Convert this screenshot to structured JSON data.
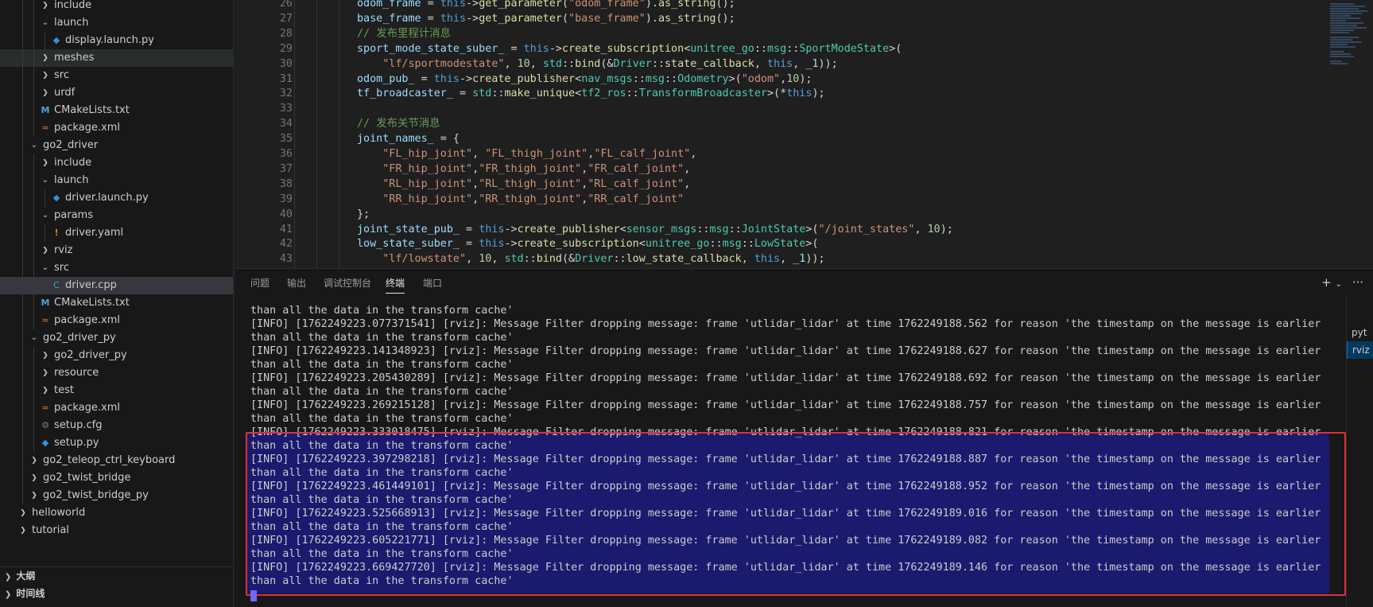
{
  "explorer": {
    "rows": [
      {
        "label": "include",
        "icon": "chevron-right",
        "depth": 2,
        "kind": "folder"
      },
      {
        "label": "launch",
        "icon": "chevron-down",
        "depth": 2,
        "kind": "folder"
      },
      {
        "label": "display.launch.py",
        "icon": "python-icon",
        "depth": 3,
        "kind": "file"
      },
      {
        "label": "meshes",
        "icon": "chevron-right",
        "depth": 2,
        "kind": "folder",
        "state": "hovered"
      },
      {
        "label": "src",
        "icon": "chevron-right",
        "depth": 2,
        "kind": "folder"
      },
      {
        "label": "urdf",
        "icon": "chevron-right",
        "depth": 2,
        "kind": "folder"
      },
      {
        "label": "CMakeLists.txt",
        "icon": "cmake-icon",
        "depth": 2,
        "kind": "file"
      },
      {
        "label": "package.xml",
        "icon": "xml-icon",
        "depth": 2,
        "kind": "file"
      },
      {
        "label": "go2_driver",
        "icon": "chevron-down",
        "depth": 1,
        "kind": "folder"
      },
      {
        "label": "include",
        "icon": "chevron-right",
        "depth": 2,
        "kind": "folder"
      },
      {
        "label": "launch",
        "icon": "chevron-down",
        "depth": 2,
        "kind": "folder"
      },
      {
        "label": "driver.launch.py",
        "icon": "python-icon",
        "depth": 3,
        "kind": "file"
      },
      {
        "label": "params",
        "icon": "chevron-down",
        "depth": 2,
        "kind": "folder"
      },
      {
        "label": "driver.yaml",
        "icon": "yaml-icon",
        "depth": 3,
        "kind": "file"
      },
      {
        "label": "rviz",
        "icon": "chevron-right",
        "depth": 2,
        "kind": "folder"
      },
      {
        "label": "src",
        "icon": "chevron-down",
        "depth": 2,
        "kind": "folder"
      },
      {
        "label": "driver.cpp",
        "icon": "cpp-icon",
        "depth": 3,
        "kind": "file",
        "state": "selected"
      },
      {
        "label": "CMakeLists.txt",
        "icon": "cmake-icon",
        "depth": 2,
        "kind": "file"
      },
      {
        "label": "package.xml",
        "icon": "xml-icon",
        "depth": 2,
        "kind": "file"
      },
      {
        "label": "go2_driver_py",
        "icon": "chevron-down",
        "depth": 1,
        "kind": "folder"
      },
      {
        "label": "go2_driver_py",
        "icon": "chevron-right",
        "depth": 2,
        "kind": "folder"
      },
      {
        "label": "resource",
        "icon": "chevron-right",
        "depth": 2,
        "kind": "folder"
      },
      {
        "label": "test",
        "icon": "chevron-right",
        "depth": 2,
        "kind": "folder"
      },
      {
        "label": "package.xml",
        "icon": "xml-icon",
        "depth": 2,
        "kind": "file"
      },
      {
        "label": "setup.cfg",
        "icon": "config-icon",
        "depth": 2,
        "kind": "file"
      },
      {
        "label": "setup.py",
        "icon": "python-icon",
        "depth": 2,
        "kind": "file"
      },
      {
        "label": "go2_teleop_ctrl_keyboard",
        "icon": "chevron-right",
        "depth": 1,
        "kind": "folder"
      },
      {
        "label": "go2_twist_bridge",
        "icon": "chevron-right",
        "depth": 1,
        "kind": "folder"
      },
      {
        "label": "go2_twist_bridge_py",
        "icon": "chevron-right",
        "depth": 1,
        "kind": "folder"
      },
      {
        "label": "helloworld",
        "icon": "chevron-right",
        "depth": 0,
        "kind": "folder"
      },
      {
        "label": "tutorial",
        "icon": "chevron-right",
        "depth": 0,
        "kind": "folder"
      }
    ],
    "sections": [
      {
        "label": "大纲",
        "icon": "chevron-right"
      },
      {
        "label": "时间线",
        "icon": "chevron-right"
      }
    ]
  },
  "editor": {
    "lines": [
      {
        "n": "26",
        "tokens": [
          [
            "var",
            "odom_frame"
          ],
          [
            "pun",
            " = "
          ],
          [
            "kw",
            "this"
          ],
          [
            "pun",
            "->"
          ],
          [
            "fn",
            "get_parameter"
          ],
          [
            "pun",
            "("
          ],
          [
            "str",
            "\"odom_frame\""
          ],
          [
            "pun",
            ")."
          ],
          [
            "fn",
            "as_string"
          ],
          [
            "pun",
            "();"
          ]
        ]
      },
      {
        "n": "27",
        "tokens": [
          [
            "var",
            "base_frame"
          ],
          [
            "pun",
            " = "
          ],
          [
            "kw",
            "this"
          ],
          [
            "pun",
            "->"
          ],
          [
            "fn",
            "get_parameter"
          ],
          [
            "pun",
            "("
          ],
          [
            "str",
            "\"base_frame\""
          ],
          [
            "pun",
            ")."
          ],
          [
            "fn",
            "as_string"
          ],
          [
            "pun",
            "();"
          ]
        ]
      },
      {
        "n": "28",
        "tokens": [
          [
            "cmt",
            "// 发布里程计消息"
          ]
        ]
      },
      {
        "n": "29",
        "tokens": [
          [
            "var",
            "sport_mode_state_suber_"
          ],
          [
            "pun",
            " = "
          ],
          [
            "kw",
            "this"
          ],
          [
            "pun",
            "->"
          ],
          [
            "fn",
            "create_subscription"
          ],
          [
            "pun",
            "<"
          ],
          [
            "ns",
            "unitree_go"
          ],
          [
            "pun",
            "::"
          ],
          [
            "ns",
            "msg"
          ],
          [
            "pun",
            "::"
          ],
          [
            "typ",
            "SportModeState"
          ],
          [
            "pun",
            ">("
          ]
        ]
      },
      {
        "n": "30",
        "tokens": [
          [
            "pun",
            "    "
          ],
          [
            "str",
            "\"lf/sportmodestate\""
          ],
          [
            "pun",
            ", "
          ],
          [
            "num",
            "10"
          ],
          [
            "pun",
            ", "
          ],
          [
            "ns",
            "std"
          ],
          [
            "pun",
            "::"
          ],
          [
            "fn",
            "bind"
          ],
          [
            "pun",
            "(&"
          ],
          [
            "ns",
            "Driver"
          ],
          [
            "pun",
            "::"
          ],
          [
            "fn",
            "state_callback"
          ],
          [
            "pun",
            ", "
          ],
          [
            "kw",
            "this"
          ],
          [
            "pun",
            ", "
          ],
          [
            "var",
            "_1"
          ],
          [
            "pun",
            "));"
          ]
        ]
      },
      {
        "n": "31",
        "tokens": [
          [
            "var",
            "odom_pub_"
          ],
          [
            "pun",
            " = "
          ],
          [
            "kw",
            "this"
          ],
          [
            "pun",
            "->"
          ],
          [
            "fn",
            "create_publisher"
          ],
          [
            "pun",
            "<"
          ],
          [
            "ns",
            "nav_msgs"
          ],
          [
            "pun",
            "::"
          ],
          [
            "ns",
            "msg"
          ],
          [
            "pun",
            "::"
          ],
          [
            "typ",
            "Odometry"
          ],
          [
            "pun",
            ">("
          ],
          [
            "str",
            "\"odom\""
          ],
          [
            "pun",
            ","
          ],
          [
            "num",
            "10"
          ],
          [
            "pun",
            ");"
          ]
        ]
      },
      {
        "n": "32",
        "tokens": [
          [
            "var",
            "tf_broadcaster_"
          ],
          [
            "pun",
            " = "
          ],
          [
            "ns",
            "std"
          ],
          [
            "pun",
            "::"
          ],
          [
            "fn",
            "make_unique"
          ],
          [
            "pun",
            "<"
          ],
          [
            "ns",
            "tf2_ros"
          ],
          [
            "pun",
            "::"
          ],
          [
            "typ",
            "TransformBroadcaster"
          ],
          [
            "pun",
            ">(*"
          ],
          [
            "kw",
            "this"
          ],
          [
            "pun",
            ");"
          ]
        ]
      },
      {
        "n": "33",
        "tokens": []
      },
      {
        "n": "34",
        "tokens": [
          [
            "cmt",
            "// 发布关节消息"
          ]
        ]
      },
      {
        "n": "35",
        "tokens": [
          [
            "var",
            "joint_names_"
          ],
          [
            "pun",
            " = {"
          ]
        ]
      },
      {
        "n": "36",
        "tokens": [
          [
            "pun",
            "    "
          ],
          [
            "str",
            "\"FL_hip_joint\""
          ],
          [
            "pun",
            ", "
          ],
          [
            "str",
            "\"FL_thigh_joint\""
          ],
          [
            "pun",
            ","
          ],
          [
            "str",
            "\"FL_calf_joint\""
          ],
          [
            "pun",
            ","
          ]
        ]
      },
      {
        "n": "37",
        "tokens": [
          [
            "pun",
            "    "
          ],
          [
            "str",
            "\"FR_hip_joint\""
          ],
          [
            "pun",
            ","
          ],
          [
            "str",
            "\"FR_thigh_joint\""
          ],
          [
            "pun",
            ","
          ],
          [
            "str",
            "\"FR_calf_joint\""
          ],
          [
            "pun",
            ","
          ]
        ]
      },
      {
        "n": "38",
        "tokens": [
          [
            "pun",
            "    "
          ],
          [
            "str",
            "\"RL_hip_joint\""
          ],
          [
            "pun",
            ","
          ],
          [
            "str",
            "\"RL_thigh_joint\""
          ],
          [
            "pun",
            ","
          ],
          [
            "str",
            "\"RL_calf_joint\""
          ],
          [
            "pun",
            ","
          ]
        ]
      },
      {
        "n": "39",
        "tokens": [
          [
            "pun",
            "    "
          ],
          [
            "str",
            "\"RR_hip_joint\""
          ],
          [
            "pun",
            ","
          ],
          [
            "str",
            "\"RR_thigh_joint\""
          ],
          [
            "pun",
            ","
          ],
          [
            "str",
            "\"RR_calf_joint\""
          ]
        ]
      },
      {
        "n": "40",
        "tokens": [
          [
            "pun",
            "};"
          ]
        ]
      },
      {
        "n": "41",
        "tokens": [
          [
            "var",
            "joint_state_pub_"
          ],
          [
            "pun",
            " = "
          ],
          [
            "kw",
            "this"
          ],
          [
            "pun",
            "->"
          ],
          [
            "fn",
            "create_publisher"
          ],
          [
            "pun",
            "<"
          ],
          [
            "ns",
            "sensor_msgs"
          ],
          [
            "pun",
            "::"
          ],
          [
            "ns",
            "msg"
          ],
          [
            "pun",
            "::"
          ],
          [
            "typ",
            "JointState"
          ],
          [
            "pun",
            ">("
          ],
          [
            "str",
            "\"/joint_states\""
          ],
          [
            "pun",
            ", "
          ],
          [
            "num",
            "10"
          ],
          [
            "pun",
            ");"
          ]
        ]
      },
      {
        "n": "42",
        "tokens": [
          [
            "var",
            "low_state_suber_"
          ],
          [
            "pun",
            " = "
          ],
          [
            "kw",
            "this"
          ],
          [
            "pun",
            "->"
          ],
          [
            "fn",
            "create_subscription"
          ],
          [
            "pun",
            "<"
          ],
          [
            "ns",
            "unitree_go"
          ],
          [
            "pun",
            "::"
          ],
          [
            "ns",
            "msg"
          ],
          [
            "pun",
            "::"
          ],
          [
            "typ",
            "LowState"
          ],
          [
            "pun",
            ">("
          ]
        ]
      },
      {
        "n": "43",
        "tokens": [
          [
            "pun",
            "    "
          ],
          [
            "str",
            "\"lf/lowstate\""
          ],
          [
            "pun",
            ", "
          ],
          [
            "num",
            "10"
          ],
          [
            "pun",
            ", "
          ],
          [
            "ns",
            "std"
          ],
          [
            "pun",
            "::"
          ],
          [
            "fn",
            "bind"
          ],
          [
            "pun",
            "(&"
          ],
          [
            "ns",
            "Driver"
          ],
          [
            "pun",
            "::"
          ],
          [
            "fn",
            "low_state_callback"
          ],
          [
            "pun",
            ", "
          ],
          [
            "kw",
            "this"
          ],
          [
            "pun",
            ", "
          ],
          [
            "var",
            "_1"
          ],
          [
            "pun",
            "));"
          ]
        ]
      }
    ]
  },
  "panel": {
    "tabs": [
      "问题",
      "输出",
      "调试控制台",
      "终端",
      "端口"
    ],
    "active_tab": "终端",
    "add_label": "+",
    "more_label": "···",
    "terminal_list": [
      "pyt",
      "rviz"
    ],
    "terminal_lines": [
      "than all the data in the transform cache'",
      "[INFO] [1762249223.077371541] [rviz]: Message Filter dropping message: frame 'utlidar_lidar' at time 1762249188.562 for reason 'the timestamp on the message is earlier",
      "than all the data in the transform cache'",
      "[INFO] [1762249223.141348923] [rviz]: Message Filter dropping message: frame 'utlidar_lidar' at time 1762249188.627 for reason 'the timestamp on the message is earlier",
      "than all the data in the transform cache'",
      "[INFO] [1762249223.205430289] [rviz]: Message Filter dropping message: frame 'utlidar_lidar' at time 1762249188.692 for reason 'the timestamp on the message is earlier",
      "than all the data in the transform cache'",
      "[INFO] [1762249223.269215128] [rviz]: Message Filter dropping message: frame 'utlidar_lidar' at time 1762249188.757 for reason 'the timestamp on the message is earlier",
      "than all the data in the transform cache'",
      "[INFO] [1762249223.333018475] [rviz]: Message Filter dropping message: frame 'utlidar_lidar' at time 1762249188.821 for reason 'the timestamp on the message is earlier",
      "than all the data in the transform cache'",
      "[INFO] [1762249223.397298218] [rviz]: Message Filter dropping message: frame 'utlidar_lidar' at time 1762249188.887 for reason 'the timestamp on the message is earlier",
      "than all the data in the transform cache'",
      "[INFO] [1762249223.461449101] [rviz]: Message Filter dropping message: frame 'utlidar_lidar' at time 1762249188.952 for reason 'the timestamp on the message is earlier",
      "than all the data in the transform cache'",
      "[INFO] [1762249223.525668913] [rviz]: Message Filter dropping message: frame 'utlidar_lidar' at time 1762249189.016 for reason 'the timestamp on the message is earlier",
      "than all the data in the transform cache'",
      "[INFO] [1762249223.605221771] [rviz]: Message Filter dropping message: frame 'utlidar_lidar' at time 1762249189.082 for reason 'the timestamp on the message is earlier",
      "than all the data in the transform cache'",
      "[INFO] [1762249223.669427720] [rviz]: Message Filter dropping message: frame 'utlidar_lidar' at time 1762249189.146 for reason 'the timestamp on the message is earlier",
      "than all the data in the transform cache'"
    ]
  },
  "colors": {
    "selection": "#1a1a6e",
    "highlight_box": "#e0303d",
    "accent": "#0078d4"
  }
}
